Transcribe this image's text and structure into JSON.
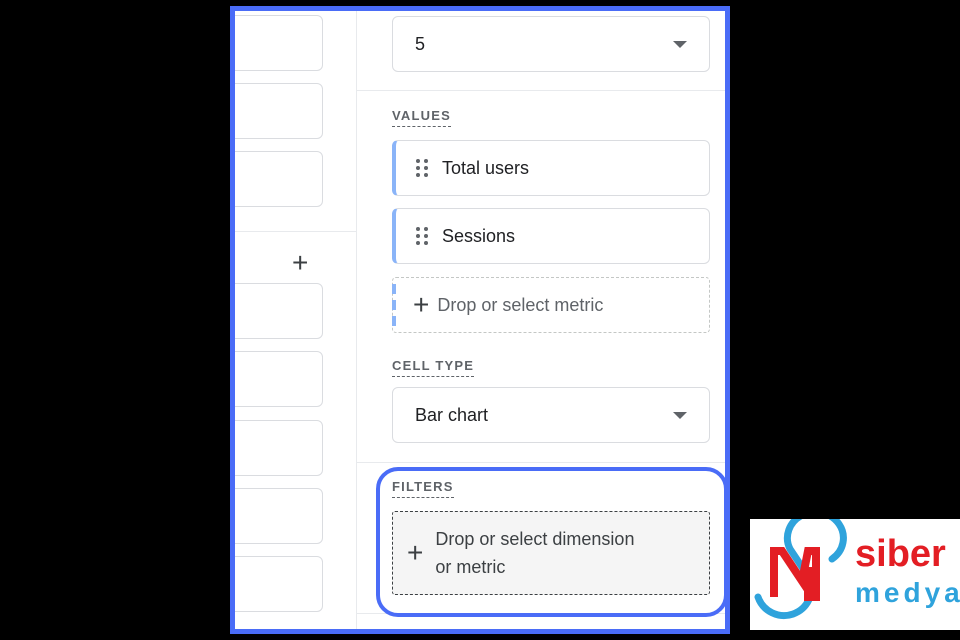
{
  "rows_select": {
    "value": "5"
  },
  "values": {
    "label": "VALUES",
    "items": [
      {
        "label": "Total users"
      },
      {
        "label": "Sessions"
      }
    ],
    "drop_label": "Drop or select metric"
  },
  "cell_type": {
    "label": "CELL TYPE",
    "value": "Bar chart"
  },
  "filters": {
    "label": "FILTERS",
    "drop_label_line1": "Drop or select dimension",
    "drop_label_line2": "or metric"
  },
  "logo": {
    "text1": "siber",
    "text2": "medya"
  },
  "colors": {
    "highlight": "#4a6cf7",
    "chip_accent": "#8ab4f8",
    "logo_red": "#e31e24",
    "logo_blue": "#2fa3dc"
  }
}
